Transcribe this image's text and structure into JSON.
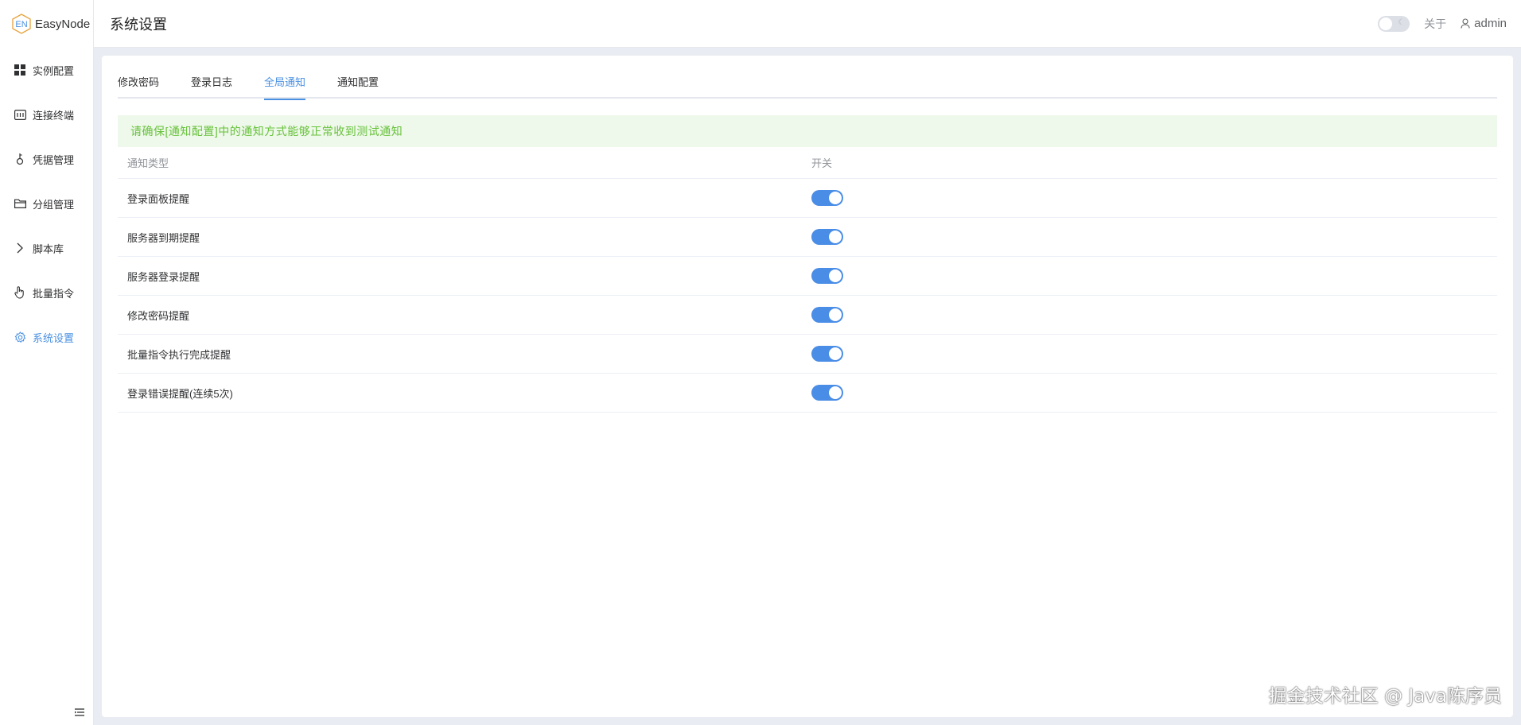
{
  "app": {
    "logo_text": "EasyNode",
    "logo_mark": "EN"
  },
  "sidebar": {
    "items": [
      {
        "label": "实例配置",
        "icon": "grid-icon"
      },
      {
        "label": "连接终端",
        "icon": "terminal-icon"
      },
      {
        "label": "凭据管理",
        "icon": "key-icon"
      },
      {
        "label": "分组管理",
        "icon": "folder-icon"
      },
      {
        "label": "脚本库",
        "icon": "chevron-right-icon"
      },
      {
        "label": "批量指令",
        "icon": "pointer-icon"
      },
      {
        "label": "系统设置",
        "icon": "gear-icon",
        "active": true
      }
    ]
  },
  "header": {
    "title": "系统设置",
    "about_label": "关于",
    "user_label": "admin"
  },
  "tabs": [
    {
      "label": "修改密码"
    },
    {
      "label": "登录日志"
    },
    {
      "label": "全局通知",
      "active": true
    },
    {
      "label": "通知配置"
    }
  ],
  "alert": {
    "text": "请确保[通知配置]中的通知方式能够正常收到测试通知"
  },
  "table": {
    "headers": {
      "type": "通知类型",
      "switch": "开关"
    },
    "rows": [
      {
        "type": "登录面板提醒",
        "enabled": true
      },
      {
        "type": "服务器到期提醒",
        "enabled": true
      },
      {
        "type": "服务器登录提醒",
        "enabled": true
      },
      {
        "type": "修改密码提醒",
        "enabled": true
      },
      {
        "type": "批量指令执行完成提醒",
        "enabled": true
      },
      {
        "type": "登录错误提醒(连续5次)",
        "enabled": true
      }
    ]
  },
  "watermark": "掘金技术社区 @ Java陈序员",
  "colors": {
    "accent": "#4a90e2",
    "alert_bg": "#eef8eb",
    "alert_text": "#67c23a",
    "switch_on": "#4a8de6"
  }
}
